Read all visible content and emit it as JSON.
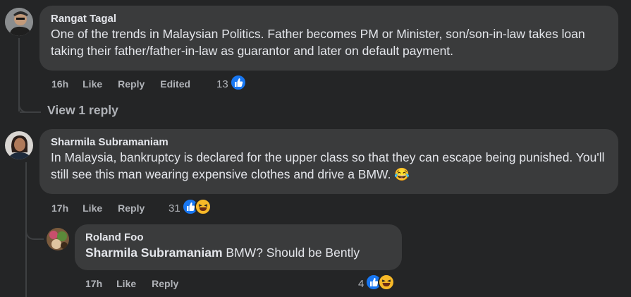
{
  "comments": [
    {
      "author": "Rangat Tagal",
      "text": "One of the trends in Malaysian Politics. Father becomes PM or Minister, son/son-in-law takes loan taking their father/father-in-law as guarantor and later on default payment.",
      "time": "16h",
      "like_label": "Like",
      "reply_label": "Reply",
      "edited_label": "Edited",
      "reaction_count": "13",
      "reactions": [
        "like-icon"
      ]
    },
    {
      "author": "Sharmila Subramaniam",
      "text": "In Malaysia, bankruptcy is declared for the upper class so that they can escape being punished. You'll still see this man wearing expensive clothes and drive a BMW.",
      "emoji": "😂",
      "time": "17h",
      "like_label": "Like",
      "reply_label": "Reply",
      "reaction_count": "31",
      "reactions": [
        "like-icon",
        "haha-icon"
      ]
    }
  ],
  "view_replies": "View 1 reply",
  "reply": {
    "author": "Roland Foo",
    "mention": "Sharmila Subramaniam",
    "text": " BMW? Should be Bently",
    "time": "17h",
    "like_label": "Like",
    "reply_label": "Reply",
    "reaction_count": "4",
    "reactions": [
      "like-icon",
      "haha-icon"
    ]
  },
  "colors": {
    "background": "#242526",
    "bubble": "#3a3b3c",
    "like_blue": "#1877f2",
    "haha_yellow": "#f7b928"
  }
}
